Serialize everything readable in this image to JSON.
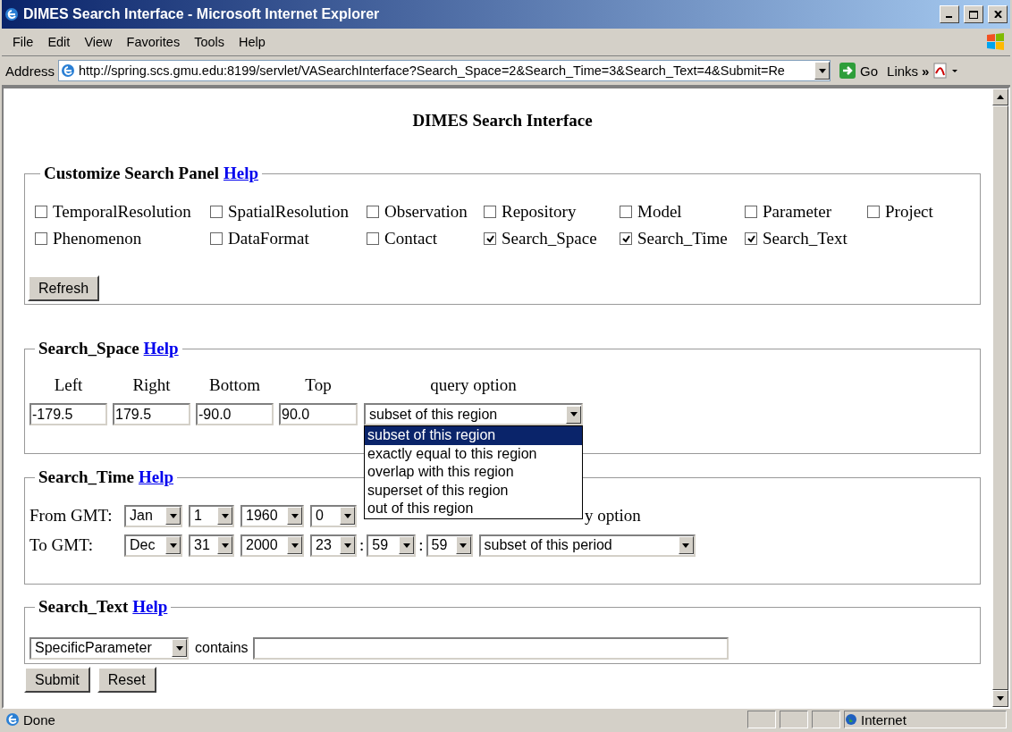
{
  "window": {
    "title": "DIMES Search Interface - Microsoft Internet Explorer"
  },
  "menu": [
    "File",
    "Edit",
    "View",
    "Favorites",
    "Tools",
    "Help"
  ],
  "address_bar": {
    "label": "Address",
    "url": "http://spring.scs.gmu.edu:8199/servlet/VASearchInterface?Search_Space=2&Search_Time=3&Search_Text=4&Submit=Re",
    "go": "Go",
    "links": "Links",
    "chevron": "»"
  },
  "page": {
    "title": "DIMES Search Interface",
    "customize": {
      "legend": "Customize Search Panel",
      "help": "Help",
      "refresh": "Refresh",
      "options": [
        {
          "label": "TemporalResolution",
          "checked": false
        },
        {
          "label": "SpatialResolution",
          "checked": false
        },
        {
          "label": "Observation",
          "checked": false
        },
        {
          "label": "Repository",
          "checked": false
        },
        {
          "label": "Model",
          "checked": false
        },
        {
          "label": "Parameter",
          "checked": false
        },
        {
          "label": "Project",
          "checked": false
        },
        {
          "label": "Phenomenon",
          "checked": false
        },
        {
          "label": "DataFormat",
          "checked": false
        },
        {
          "label": "Contact",
          "checked": false
        },
        {
          "label": "Search_Space",
          "checked": true
        },
        {
          "label": "Search_Time",
          "checked": true
        },
        {
          "label": "Search_Text",
          "checked": true
        }
      ]
    },
    "search_space": {
      "legend": "Search_Space",
      "help": "Help",
      "fields": [
        {
          "label": "Left",
          "value": "-179.5"
        },
        {
          "label": "Right",
          "value": "179.5"
        },
        {
          "label": "Bottom",
          "value": "-90.0"
        },
        {
          "label": "Top",
          "value": "90.0"
        }
      ],
      "query_label": "query option",
      "query_value": "subset of this region",
      "dropdown_open": true,
      "options": [
        {
          "label": "subset of this region",
          "selected": true
        },
        {
          "label": "exactly equal to this region",
          "selected": false
        },
        {
          "label": "overlap with this region",
          "selected": false
        },
        {
          "label": "superset of this region",
          "selected": false
        },
        {
          "label": "out of this region",
          "selected": false
        }
      ]
    },
    "search_time": {
      "legend": "Search_Time",
      "help": "Help",
      "query_label_visible": "y option",
      "rows": [
        {
          "label": "From GMT:",
          "parts": [
            {
              "kind": "select",
              "value": "Jan"
            },
            {
              "kind": "select",
              "value": "1"
            },
            {
              "kind": "select",
              "value": "1960"
            },
            {
              "kind": "select",
              "value": "0"
            }
          ]
        },
        {
          "label": "To GMT:",
          "parts": [
            {
              "kind": "select",
              "value": "Dec"
            },
            {
              "kind": "select",
              "value": "31"
            },
            {
              "kind": "select",
              "value": "2000"
            },
            {
              "kind": "select",
              "value": "23"
            },
            {
              "kind": "sep",
              "value": ":"
            },
            {
              "kind": "select",
              "value": "59"
            },
            {
              "kind": "sep",
              "value": ":"
            },
            {
              "kind": "select",
              "value": "59"
            },
            {
              "kind": "select",
              "value": "subset of this period"
            }
          ]
        }
      ]
    },
    "search_text": {
      "legend": "Search_Text",
      "help": "Help",
      "field_select": "SpecificParameter",
      "contains": "contains"
    },
    "buttons": [
      "Submit",
      "Reset"
    ]
  },
  "status_bar": {
    "text": "Done",
    "zone": "Internet"
  }
}
